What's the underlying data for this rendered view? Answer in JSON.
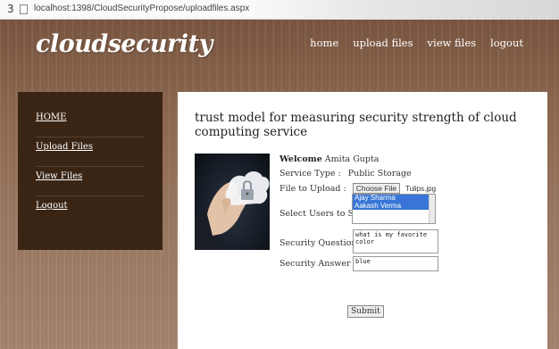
{
  "browser": {
    "tab_number": "3",
    "url": "localhost:1398/CloudSecurityPropose/uploadfiles.aspx"
  },
  "site": {
    "logo": "cloudsecurity",
    "nav": [
      "home",
      "upload files",
      "view files",
      "logout"
    ]
  },
  "sidebar": {
    "items": [
      "HOME",
      "Upload Files",
      "View Files",
      "Logout"
    ]
  },
  "main": {
    "title": "trust model for measuring security strength of cloud computing service",
    "welcome_label": "Welcome",
    "welcome_user": "Amita Gupta",
    "service_type_label": "Service Type :",
    "service_type_value": "Public Storage",
    "file_label": "File to Upload :",
    "choose_file": "Choose File",
    "file_name": "Tulips.jpg",
    "share_label": "Select Users to Share :",
    "users": [
      "Ajay Sharma",
      "Aakash Verma"
    ],
    "question_label": "Security Question :",
    "question_value": "what is my favorite color",
    "answer_label": "Security Answer  :",
    "answer_value": "blue",
    "submit": "Submit"
  }
}
